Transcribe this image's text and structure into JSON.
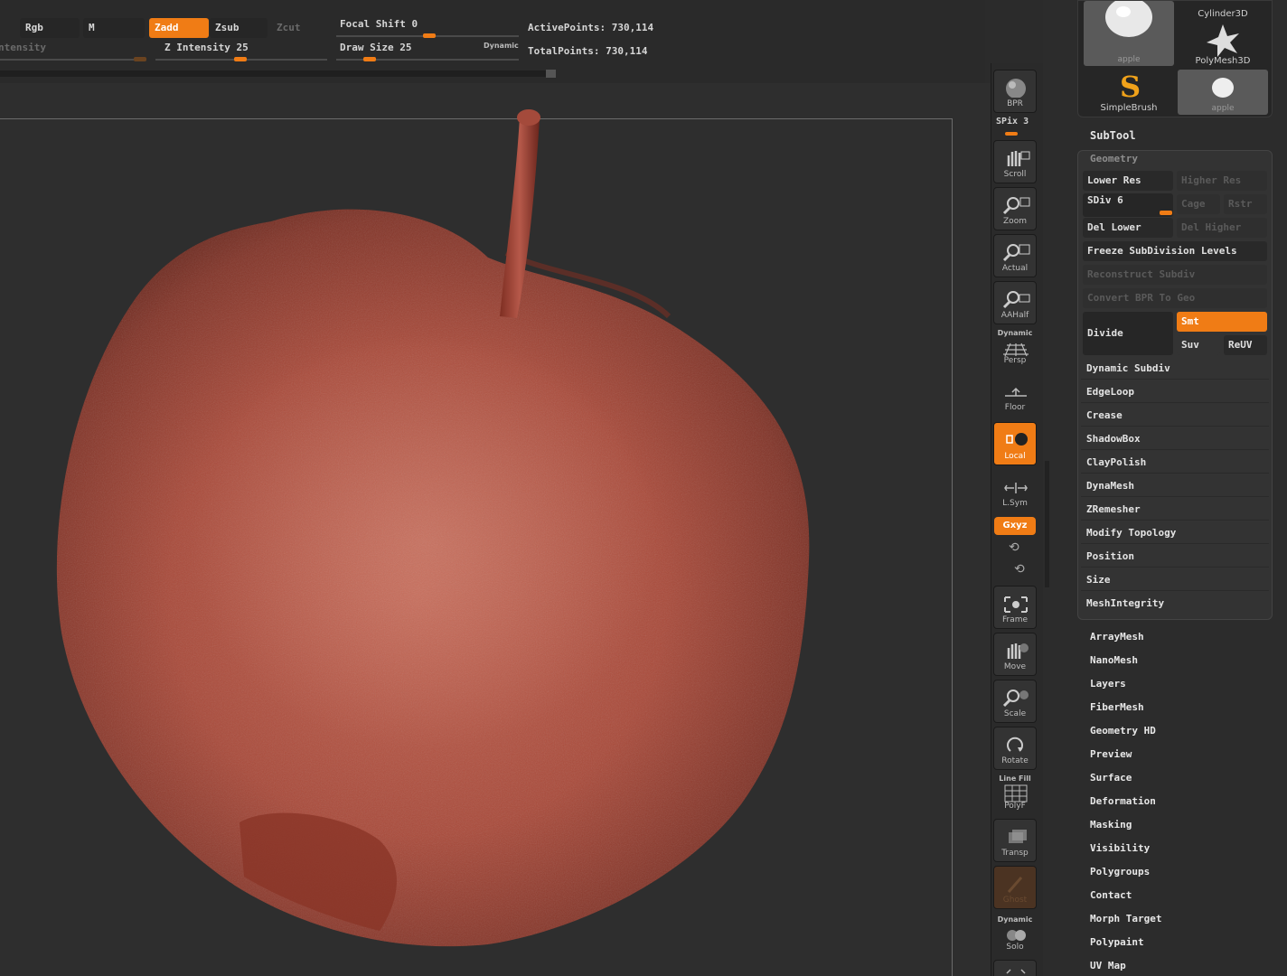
{
  "toolbar": {
    "rgb": "Rgb",
    "m": "M",
    "zadd": "Zadd",
    "zsub": "Zsub",
    "zcut": "Zcut",
    "intensity_label": "ntensity",
    "z_intensity": "Z Intensity 25",
    "focal_shift": "Focal Shift 0",
    "draw_size": "Draw Size 25",
    "dynamic": "Dynamic",
    "active_points": "ActivePoints: 730,114",
    "total_points": "TotalPoints: 730,114"
  },
  "shelf": {
    "bpr": "BPR",
    "spix": "SPix 3",
    "scroll": "Scroll",
    "zoom": "Zoom",
    "actual": "Actual",
    "aahalf": "AAHalf",
    "persp_top": "Dynamic",
    "persp": "Persp",
    "floor": "Floor",
    "local": "Local",
    "lsym": "L.Sym",
    "xyz": "Gxyz",
    "frame": "Frame",
    "move": "Move",
    "scale": "Scale",
    "rotate": "Rotate",
    "polyf_top": "Line Fill",
    "polyf": "PolyF",
    "transp": "Transp",
    "ghost": "Ghost",
    "solo_top": "Dynamic",
    "solo": "Solo"
  },
  "tools": [
    {
      "name": "apple",
      "selected": true
    },
    {
      "name": "Cylinder3D"
    },
    {
      "name": "PolyMesh3D"
    },
    {
      "name": "SimpleBrush"
    },
    {
      "name": "apple",
      "selected": true
    }
  ],
  "subtool": "SubTool",
  "geometry": {
    "title": "Geometry",
    "lower_res": "Lower Res",
    "higher_res": "Higher Res",
    "sdiv": "SDiv 6",
    "cage": "Cage",
    "rstr": "Rstr",
    "del_lower": "Del Lower",
    "del_higher": "Del Higher",
    "freeze": "Freeze SubDivision Levels",
    "reconstruct": "Reconstruct Subdiv",
    "convert": "Convert BPR To Geo",
    "divide": "Divide",
    "smt": "Smt",
    "suv": "Suv",
    "reuv": "ReUV",
    "items": [
      "Dynamic Subdiv",
      "EdgeLoop",
      "Crease",
      "ShadowBox",
      "ClayPolish",
      "DynaMesh",
      "ZRemesher",
      "Modify Topology",
      "Position",
      "Size",
      "MeshIntegrity"
    ]
  },
  "menu": [
    "ArrayMesh",
    "NanoMesh",
    "Layers",
    "FiberMesh",
    "Geometry HD",
    "Preview",
    "Surface",
    "Deformation",
    "Masking",
    "Visibility",
    "Polygroups",
    "Contact",
    "Morph Target",
    "Polypaint",
    "UV Map"
  ],
  "colors": {
    "accent": "#f07c15",
    "apple": "#a94a3a"
  }
}
